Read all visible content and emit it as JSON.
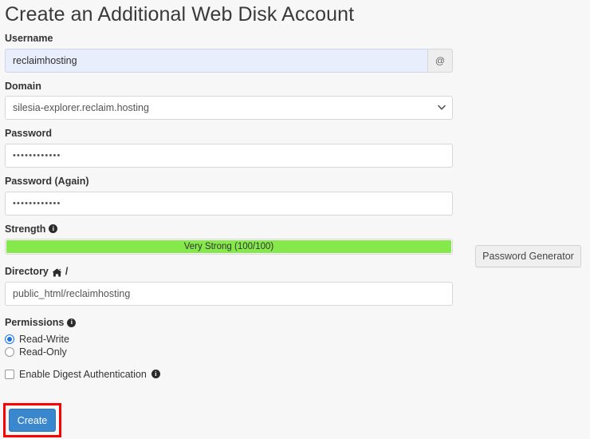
{
  "page": {
    "title": "Create an Additional Web Disk Account",
    "background_color": "#f7f7f8"
  },
  "form": {
    "username": {
      "label": "Username",
      "value": "reclaimhosting",
      "placeholder": "Username",
      "addon": "@"
    },
    "domain": {
      "label": "Domain",
      "selected": "silesia-explorer.reclaim.hosting",
      "options": [
        "silesia-explorer.reclaim.hosting"
      ],
      "chevron_icon": "chevron-down-icon"
    },
    "password": {
      "label": "Password",
      "value": "••••••••••••",
      "placeholder": ""
    },
    "password_again": {
      "label": "Password (Again)",
      "value": "••••••••••••",
      "placeholder": ""
    },
    "strength": {
      "label": "Strength",
      "info_icon": "info-icon",
      "text": "Very Strong (100/100)",
      "score": 100,
      "max_score": 100,
      "percent": 100,
      "bar_color": "#85e94c"
    },
    "password_generator": {
      "label": "Password Generator"
    },
    "directory": {
      "label": "Directory",
      "home_icon": "home-icon",
      "label_suffix": "/",
      "value": "public_html/reclaimhosting",
      "placeholder": ""
    },
    "permissions": {
      "label": "Permissions",
      "info_icon": "info-icon",
      "options": [
        {
          "label": "Read-Write",
          "selected": true
        },
        {
          "label": "Read-Only",
          "selected": false
        }
      ],
      "digest": {
        "label": "Enable Digest Authentication",
        "checked": false,
        "info_icon": "info-icon"
      }
    },
    "submit": {
      "label": "Create",
      "color": "#3b87cd",
      "highlight_color": "#ff0000"
    }
  }
}
